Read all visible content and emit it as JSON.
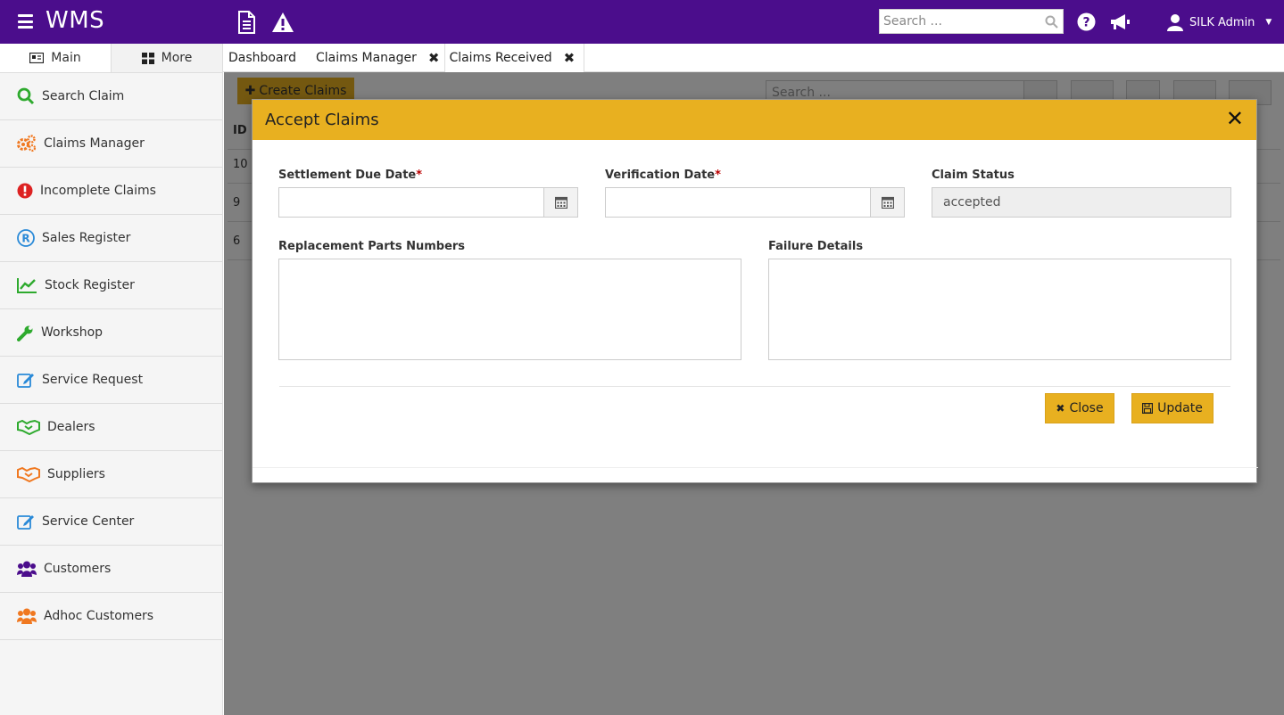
{
  "app": {
    "brand": "WMS",
    "search_placeholder": "Search ...",
    "user_name": "SILK Admin"
  },
  "sidebar": {
    "tabs": [
      {
        "label": "Main"
      },
      {
        "label": "More"
      }
    ],
    "items": [
      {
        "label": "Search Claim",
        "icon": "search-icon",
        "color": "#2eaa2e"
      },
      {
        "label": "Claims Manager",
        "icon": "gears-icon",
        "color": "#f07820"
      },
      {
        "label": "Incomplete Claims",
        "icon": "exclamation-circle-icon",
        "color": "#dd2222"
      },
      {
        "label": "Sales Register",
        "icon": "registered-icon",
        "color": "#2a8ad8"
      },
      {
        "label": "Stock Register",
        "icon": "line-chart-icon",
        "color": "#2eaa2e"
      },
      {
        "label": "Workshop",
        "icon": "wrench-icon",
        "color": "#2eaa2e"
      },
      {
        "label": "Service Request",
        "icon": "edit-icon",
        "color": "#2a8ad8"
      },
      {
        "label": "Dealers",
        "icon": "handshake-icon",
        "color": "#2eaa2e"
      },
      {
        "label": "Suppliers",
        "icon": "handshake-icon",
        "color": "#f07820"
      },
      {
        "label": "Service Center",
        "icon": "edit-icon",
        "color": "#2a8ad8"
      },
      {
        "label": "Customers",
        "icon": "users-icon",
        "color": "#4b0d8c"
      },
      {
        "label": "Adhoc Customers",
        "icon": "users-icon",
        "color": "#f07820"
      }
    ]
  },
  "tabs": [
    {
      "label": "Dashboard"
    },
    {
      "label": "Claims Manager"
    },
    {
      "label": "Claims Received"
    }
  ],
  "background": {
    "create_label": "Create Claims",
    "search_placeholder": "Search ...",
    "col_id": "ID",
    "rows": [
      "10",
      "9",
      "6"
    ]
  },
  "modal": {
    "title": "Accept Claims",
    "settlement_label": "Settlement Due Date",
    "verification_label": "Verification Date",
    "status_label": "Claim Status",
    "status_value": "accepted",
    "parts_label": "Replacement Parts Numbers",
    "failure_label": "Failure Details",
    "close_label": "Close",
    "update_label": "Update",
    "required_mark": "*"
  },
  "colors": {
    "topbar": "#4b0d8c",
    "accent": "#e8b020"
  }
}
